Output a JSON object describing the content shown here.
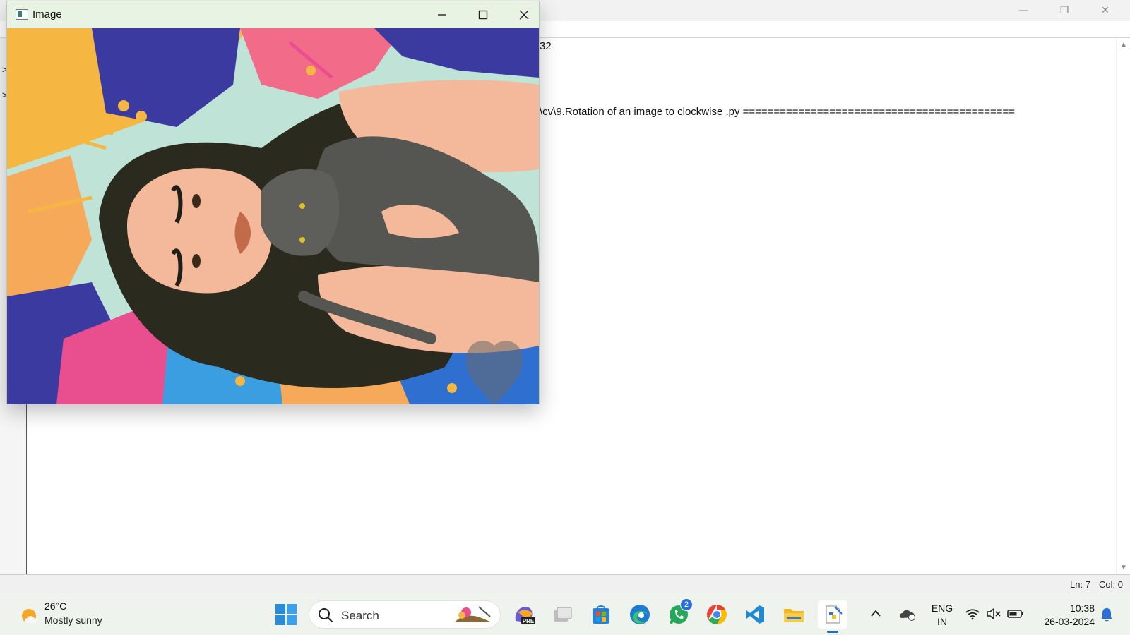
{
  "shell": {
    "output_line_1": "32",
    "output_line_2": "\\cv\\9.Rotation of an image to clockwise .py ============================================",
    "gutter_prompt": ">",
    "status": {
      "line": "Ln: 7",
      "col": "Col: 0"
    },
    "controls": {
      "minimize": "—",
      "restore": "❐",
      "close": "✕"
    }
  },
  "image_window": {
    "title": "Image",
    "content": "rotated illustration of a woman with long wavy dark hair holding a grey cat, surrounded by tropical leaves and flowers"
  },
  "taskbar": {
    "weather": {
      "temp": "26°C",
      "desc": "Mostly sunny"
    },
    "search_label": "Search",
    "apps": [
      {
        "name": "copilot-pre",
        "icon": "copilot-pre-icon"
      },
      {
        "name": "task-view",
        "icon": "task-view-icon"
      },
      {
        "name": "microsoft-store",
        "icon": "store-icon"
      },
      {
        "name": "edge",
        "icon": "edge-icon"
      },
      {
        "name": "whatsapp",
        "icon": "whatsapp-icon",
        "badge": "2"
      },
      {
        "name": "chrome",
        "icon": "chrome-icon"
      },
      {
        "name": "vscode",
        "icon": "vscode-icon"
      },
      {
        "name": "file-explorer",
        "icon": "folder-icon"
      },
      {
        "name": "python-idle",
        "icon": "python-idle-icon",
        "active": true
      }
    ],
    "language": {
      "line1": "ENG",
      "line2": "IN"
    },
    "clock": {
      "time": "10:38",
      "date": "26-03-2024"
    }
  },
  "colors": {
    "taskbar_bg": "#eef3ee",
    "image_titlebar_bg": "#e9f3e3",
    "accent": "#1a73b8"
  }
}
